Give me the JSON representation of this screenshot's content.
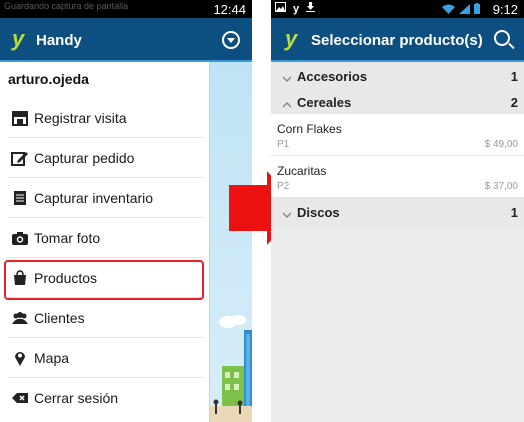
{
  "left_screen": {
    "status_bar": {
      "notification_text": "Guardando captura de pantalla",
      "time": "12:44"
    },
    "action_bar": {
      "logo": "y",
      "title": "Handy",
      "overflow_icon": "overflow-menu-icon"
    },
    "drawer": {
      "username": "arturo.ojeda",
      "items": [
        {
          "label": "Registrar visita",
          "icon": "store-icon"
        },
        {
          "label": "Capturar pedido",
          "icon": "edit-icon"
        },
        {
          "label": "Capturar inventario",
          "icon": "inventory-icon"
        },
        {
          "label": "Tomar foto",
          "icon": "camera-icon"
        },
        {
          "label": "Productos",
          "icon": "shopping-bag-icon",
          "highlighted": true
        },
        {
          "label": "Clientes",
          "icon": "people-icon"
        },
        {
          "label": "Mapa",
          "icon": "map-pin-icon"
        },
        {
          "label": "Cerrar sesión",
          "icon": "logout-icon"
        }
      ]
    }
  },
  "right_screen": {
    "status_bar": {
      "time": "9:12",
      "left_icons": [
        "image-icon",
        "y-icon",
        "download-icon"
      ],
      "right_icons": [
        "wifi-icon",
        "signal-icon",
        "battery-icon"
      ]
    },
    "action_bar": {
      "logo": "y",
      "title": "Seleccionar producto(s)",
      "search_icon": "search-icon"
    },
    "groups": [
      {
        "label": "Accesorios",
        "count": "1",
        "expanded": false,
        "products": []
      },
      {
        "label": "Cereales",
        "count": "2",
        "expanded": true,
        "products": [
          {
            "name": "Corn Flakes",
            "code": "P1",
            "price": "$ 49,00"
          },
          {
            "name": "Zucaritas",
            "code": "P2",
            "price": "$ 37,00"
          }
        ]
      },
      {
        "label": "Discos",
        "count": "1",
        "expanded": false,
        "products": []
      }
    ]
  },
  "colors": {
    "action_bar": "#0d4f80",
    "action_bar_accent": "#3a9ad9",
    "logo": "#b8dc3c",
    "highlight_border": "#e8202a",
    "arrow": "#ee1111"
  }
}
